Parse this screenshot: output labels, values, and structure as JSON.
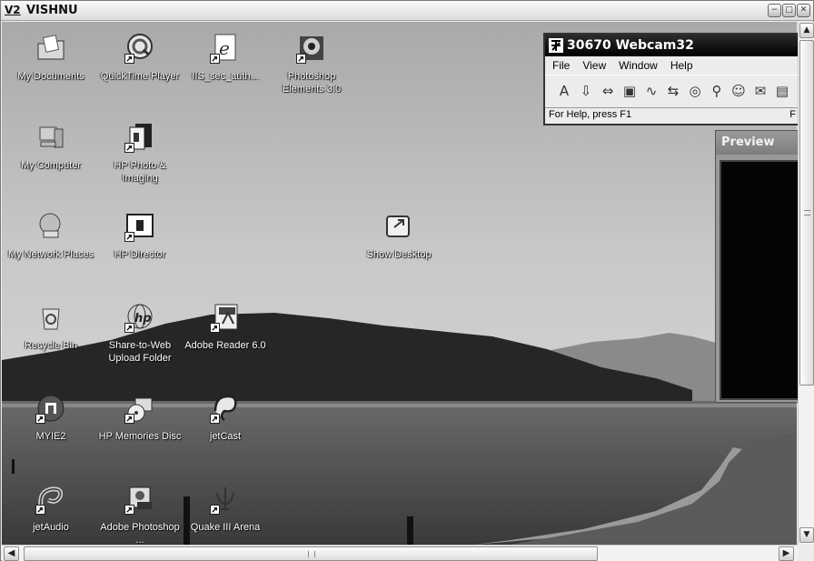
{
  "window": {
    "logo": "V2",
    "title": "VISHNU",
    "minimize_symbol": "−",
    "restore_symbol": "□",
    "close_symbol": "✕"
  },
  "desktop_icons": [
    {
      "id": "my-documents",
      "label": "My Documents",
      "icon": "folder-document-icon",
      "shortcut": false
    },
    {
      "id": "quicktime-player",
      "label": "QuickTime Player",
      "icon": "quicktime-icon",
      "shortcut": true
    },
    {
      "id": "iis-sec-auth",
      "label": "IIS_sec_auth...",
      "icon": "internet-explorer-icon",
      "shortcut": true
    },
    {
      "id": "photoshop-elements",
      "label": "Photoshop Elements 3.0",
      "icon": "sunflower-icon",
      "shortcut": true
    },
    {
      "id": "my-computer",
      "label": "My Computer",
      "icon": "computer-icon",
      "shortcut": false
    },
    {
      "id": "hp-photo-imaging",
      "label": "HP Photo & Imaging",
      "icon": "hp-photo-icon",
      "shortcut": true
    },
    {
      "id": "my-network-places",
      "label": "My Network Places",
      "icon": "network-icon",
      "shortcut": false
    },
    {
      "id": "hp-director",
      "label": "HP Director",
      "icon": "hp-director-icon",
      "shortcut": true
    },
    {
      "id": "show-desktop",
      "label": "Show Desktop",
      "icon": "show-desktop-icon",
      "shortcut": false
    },
    {
      "id": "recycle-bin",
      "label": "Recycle Bin",
      "icon": "recycle-bin-icon",
      "shortcut": false
    },
    {
      "id": "share-to-web",
      "label": "Share-to-Web Upload Folder",
      "icon": "globe-hp-icon",
      "shortcut": true
    },
    {
      "id": "adobe-reader",
      "label": "Adobe Reader 6.0",
      "icon": "adobe-reader-icon",
      "shortcut": true
    },
    {
      "id": "myie2",
      "label": "MYIE2",
      "icon": "myie2-icon",
      "shortcut": true
    },
    {
      "id": "hp-memories-disc",
      "label": "HP Memories Disc",
      "icon": "memories-disc-icon",
      "shortcut": true
    },
    {
      "id": "jetcast",
      "label": "jetCast",
      "icon": "jetcast-icon",
      "shortcut": true
    },
    {
      "id": "jetaudio",
      "label": "jetAudio",
      "icon": "jetaudio-icon",
      "shortcut": true
    },
    {
      "id": "adobe-photoshop",
      "label": "Adobe Photoshop ...",
      "icon": "photoshop-icon",
      "shortcut": true
    },
    {
      "id": "quake3",
      "label": "Quake III Arena",
      "icon": "quake-icon",
      "shortcut": true
    }
  ],
  "webcam_window": {
    "title": "30670 Webcam32",
    "menu": [
      "File",
      "View",
      "Window",
      "Help"
    ],
    "tools": [
      "A",
      "⇩",
      "⇔",
      "▣",
      "∿",
      "⇆",
      "◎",
      "⚲",
      "☺",
      "✉",
      "▤"
    ],
    "status_left": "For Help, press F1",
    "status_right": "F"
  },
  "preview_window": {
    "title": "Preview"
  },
  "scrollbars": {
    "up_symbol": "▲",
    "down_symbol": "▼",
    "left_symbol": "◀",
    "right_symbol": "▶"
  }
}
